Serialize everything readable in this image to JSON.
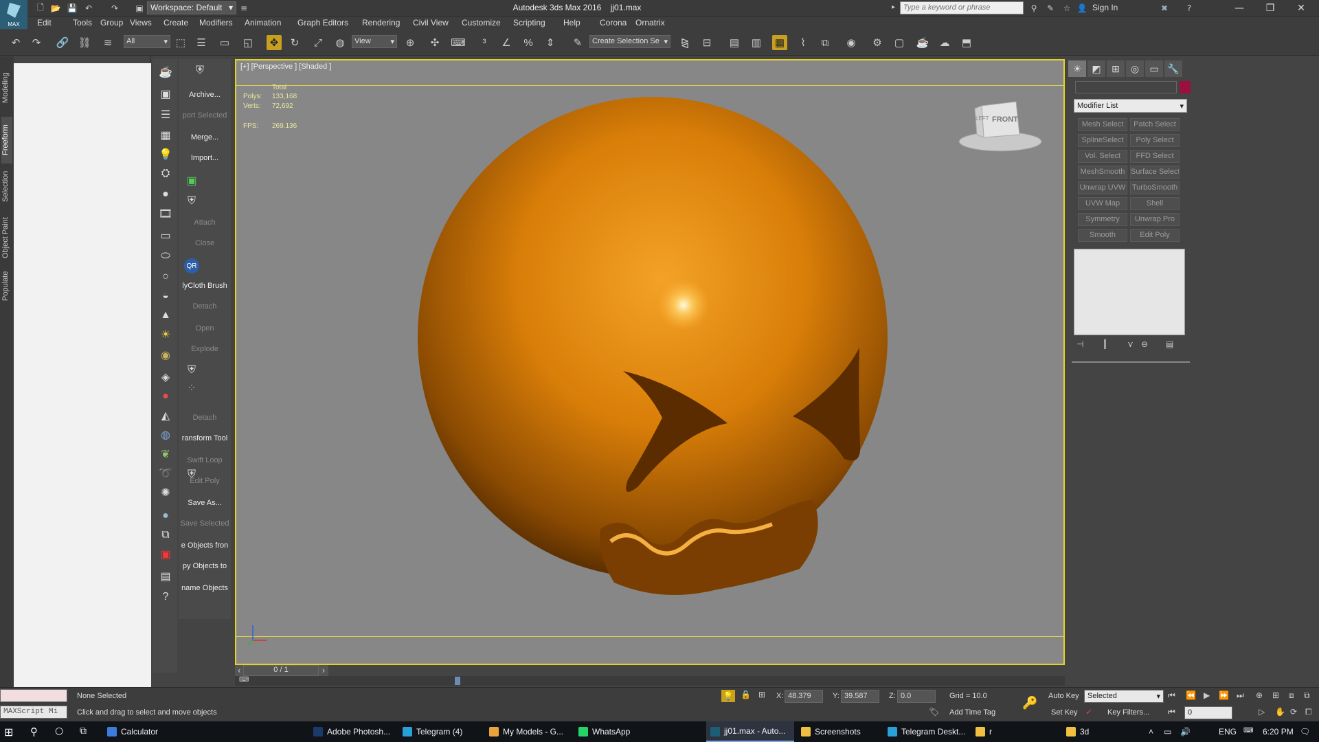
{
  "app": {
    "logo_label": "MAX",
    "workspace": "Workspace: Default",
    "title": "Autodesk 3ds Max 2016",
    "filename": "jj01.max",
    "search_placeholder": "Type a keyword or phrase",
    "signin": "Sign In"
  },
  "menu": [
    "Edit",
    "Tools",
    "Group",
    "Views",
    "Create",
    "Modifiers",
    "Animation",
    "Graph Editors",
    "Rendering",
    "Civil View",
    "Customize",
    "Scripting",
    "Help",
    "Corona",
    "Ornatrix"
  ],
  "toolbar": {
    "filter": "All",
    "ref_coord": "View",
    "selection_set": "Create Selection Se"
  },
  "ribbon_tabs": [
    "Modeling",
    "Freeform",
    "Selection",
    "Object Paint",
    "Populate"
  ],
  "tool_panel": [
    {
      "label": "Archive...",
      "dim": false
    },
    {
      "label": "port Selected",
      "dim": true
    },
    {
      "label": "Merge...",
      "dim": false
    },
    {
      "label": "Import...",
      "dim": false
    },
    {
      "label": "Attach",
      "dim": true
    },
    {
      "label": "Close",
      "dim": true
    },
    {
      "label": "lyCloth Brush",
      "dim": false
    },
    {
      "label": "Detach",
      "dim": true
    },
    {
      "label": "Open",
      "dim": true
    },
    {
      "label": "Explode",
      "dim": true
    },
    {
      "label": "Detach",
      "dim": true
    },
    {
      "label": "ransform Tool",
      "dim": false
    },
    {
      "label": "Swift Loop",
      "dim": true
    },
    {
      "label": "Edit Poly",
      "dim": true
    },
    {
      "label": "Save As...",
      "dim": false
    },
    {
      "label": "Save Selected",
      "dim": true
    },
    {
      "label": "e Objects fron",
      "dim": false
    },
    {
      "label": "py Objects to",
      "dim": false
    },
    {
      "label": "name Objects",
      "dim": false
    }
  ],
  "viewport": {
    "label": "[+] [Perspective ] [Shaded ]",
    "stats_header": "Total",
    "polys_label": "Polys:",
    "polys": "133,168",
    "verts_label": "Verts:",
    "verts": "72,692",
    "fps_label": "FPS:",
    "fps": "269.136",
    "viewcube_face": "FRONT",
    "viewcube_side": "LEFT",
    "object_color": "#d97e08"
  },
  "frame_counter": "0 / 1",
  "command_panel": {
    "modifier_list": "Modifier List",
    "buttons": [
      "Mesh Select",
      "Patch Select",
      "SplineSelect",
      "Poly Select",
      "Vol. Select",
      "FFD Select",
      "MeshSmooth",
      "Surface Select",
      "Unwrap UVW",
      "TurboSmooth",
      "UVW Map",
      "Shell",
      "Symmetry",
      "Unwrap Pro",
      "Smooth",
      "Edit Poly"
    ]
  },
  "status": {
    "maxscript": "MAXScript Mi",
    "selection": "None Selected",
    "prompt": "Click and drag to select and move objects",
    "x_label": "X:",
    "x": "48.379",
    "y_label": "Y:",
    "y": "39.587",
    "z_label": "Z:",
    "z": "0.0",
    "grid": "Grid = 10.0",
    "add_time_tag": "Add Time Tag",
    "auto_key": "Auto Key",
    "set_key": "Set Key",
    "key_mode": "Selected",
    "key_filters": "Key Filters...",
    "frame": "0"
  },
  "taskbar": {
    "items": [
      "Calculator",
      "Adobe Photosh...",
      "Telegram (4)",
      "My Models - G...",
      "WhatsApp",
      "jj01.max - Auto...",
      "Screenshots",
      "Telegram Deskt...",
      "r",
      "3d"
    ],
    "lang": "ENG",
    "time": "6:20 PM"
  }
}
